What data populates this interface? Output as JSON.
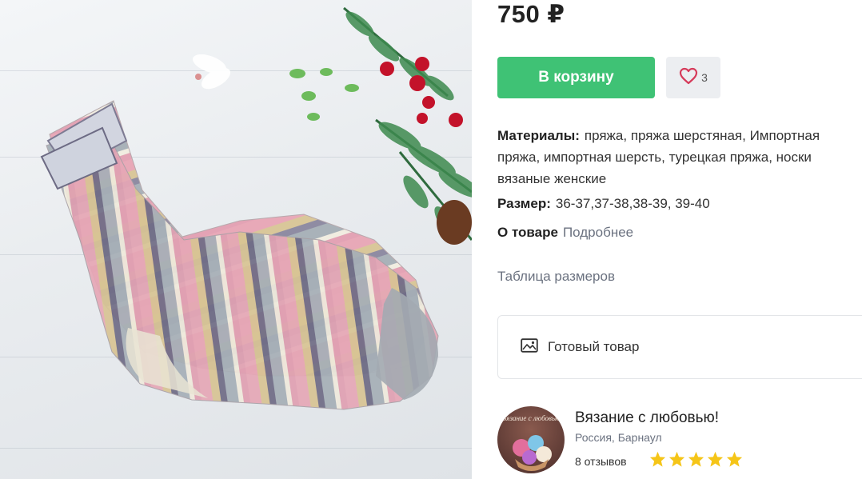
{
  "product": {
    "price": "750 ₽",
    "cart_button": "В корзину",
    "favorites_count": "3",
    "materials_label": "Материалы:",
    "materials_value": "пряжа, пряжа шерстяная, Импортная пряжа, импортная шерсть, турецкая пряжа, носки вязаные женские",
    "size_label": "Размер:",
    "size_value": "36-37,37-38,38-39, 39-40",
    "about_label": "О товаре",
    "about_link": "Подробнее",
    "size_table_link": "Таблица размеров",
    "ready_label": "Готовый товар"
  },
  "seller": {
    "name": "Вязание с любовью!",
    "location": "Россия, Барнаул",
    "reviews": "8 отзывов",
    "rating": 5,
    "avatar_text": "Вязание с любовью"
  },
  "colors": {
    "accent_green": "#3fc275",
    "heart": "#d63a5a",
    "star": "#f5c518",
    "muted_text": "#6b7280"
  },
  "icons": {
    "favorite": "heart-icon",
    "ready": "image-icon",
    "rating": "star-icon"
  }
}
